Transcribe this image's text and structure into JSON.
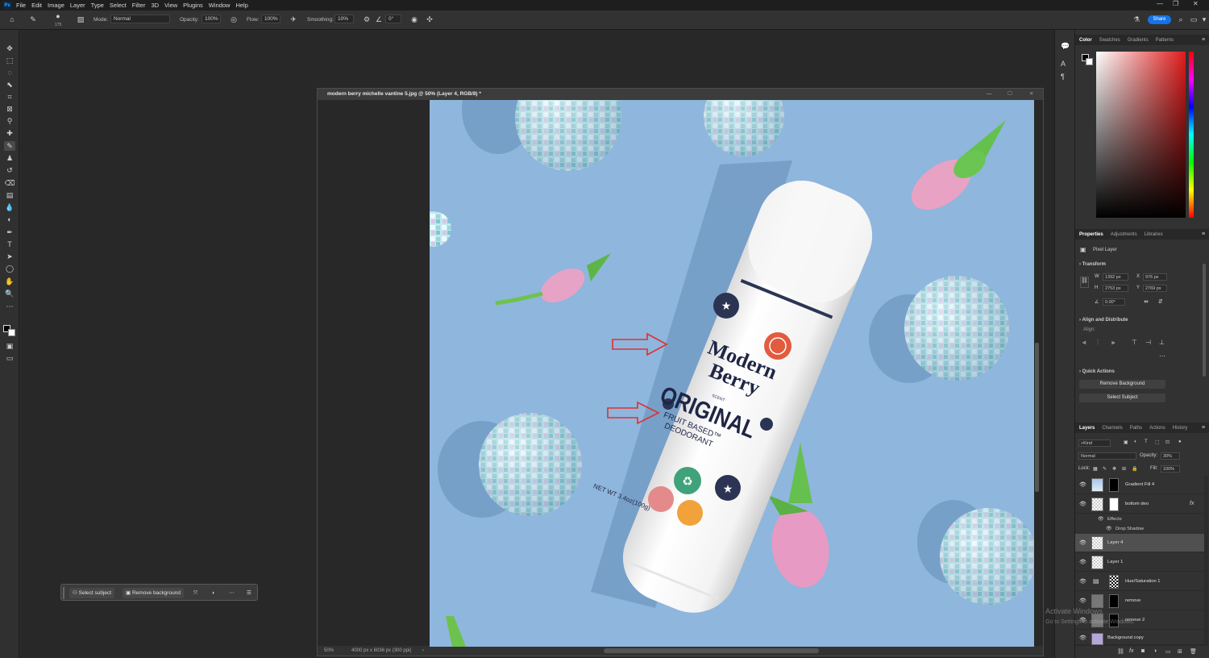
{
  "menubar": {
    "app_icon": "Ps",
    "items": [
      "File",
      "Edit",
      "Image",
      "Layer",
      "Type",
      "Select",
      "Filter",
      "3D",
      "View",
      "Plugins",
      "Window",
      "Help"
    ]
  },
  "options": {
    "brush_size": "175",
    "mode_label": "Mode:",
    "mode_value": "Normal",
    "opacity_label": "Opacity:",
    "opacity_value": "100%",
    "flow_label": "Flow:",
    "flow_value": "100%",
    "smoothing_label": "Smoothing:",
    "smoothing_value": "10%",
    "angle_value": "0°",
    "share_label": "Share"
  },
  "document": {
    "title": "modern berry michelle vantine 5.jpg @ 50% (Layer 4, RGB/8) *",
    "zoom": "50%",
    "doc_info": "4000 px x 6036 px (300 ppi)"
  },
  "photo": {
    "brand_line1": "Modern",
    "brand_line2": "Berry",
    "scent_label": "SCENT",
    "product_name": "ORIGINAL",
    "subtitle_line1": "FRUIT BASED™",
    "subtitle_line2": "DEODORANT",
    "net_weight": "NET WT 3.4oz(100g)",
    "badge_colors": {
      "green": "#3fa27a",
      "pink": "#e58a8a",
      "orange": "#f1a23a",
      "navy": "#2b3453",
      "red": "#e25b3f"
    },
    "background_color": "#8fb6dd",
    "arrow_color": "#e03030"
  },
  "contextbar": {
    "select_subject": "Select subject",
    "remove_background": "Remove background"
  },
  "color_panel": {
    "tabs": [
      "Color",
      "Swatches",
      "Gradients",
      "Patterns"
    ]
  },
  "properties": {
    "tabs": [
      "Properties",
      "Adjustments",
      "Libraries"
    ],
    "layer_type": "Pixel Layer",
    "transform_heading": "Transform",
    "w_label": "W",
    "w_value": "1392 px",
    "h_label": "H",
    "h_value": "2753 px",
    "x_label": "X",
    "x_value": "976 px",
    "y_label": "Y",
    "y_value": "2769 px",
    "angle_value": "0.00°",
    "align_heading": "Align and Distribute",
    "align_label": "Align:",
    "quick_actions_heading": "Quick Actions",
    "remove_background_btn": "Remove Background",
    "select_subject_btn": "Select Subject"
  },
  "layers_panel": {
    "tabs": [
      "Layers",
      "Channels",
      "Paths",
      "Actions",
      "History"
    ],
    "filter_kind": "Kind",
    "blend_mode": "Normal",
    "opacity_label": "Opacity:",
    "opacity_value": "30%",
    "lock_label": "Lock:",
    "fill_label": "Fill:",
    "fill_value": "100%",
    "layers": [
      {
        "name": "Gradient Fill 4"
      },
      {
        "name": "bottom deo",
        "fx": "fx"
      },
      {
        "name": "Effects"
      },
      {
        "name": "Drop Shadow"
      },
      {
        "name": "Layer 4"
      },
      {
        "name": "Layer 1"
      },
      {
        "name": "Hue/Saturation 1"
      },
      {
        "name": "remove"
      },
      {
        "name": "remove 2"
      },
      {
        "name": "Background copy"
      }
    ]
  },
  "watermark": {
    "line1": "Activate Windows",
    "line2": "Go to Settings to activate Windows."
  }
}
